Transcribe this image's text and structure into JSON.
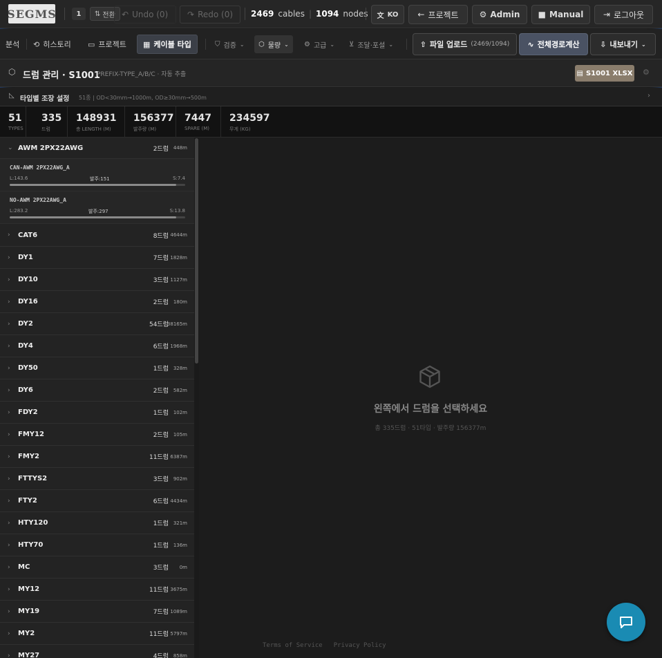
{
  "topbar": {
    "logo_text": "SEGMS",
    "badge": "1",
    "switch_label": "전환",
    "undo_label": "Undo (0)",
    "redo_label": "Redo (0)",
    "cables_count": "2469",
    "cables_label": "cables",
    "nodes_count": "1094",
    "nodes_label": "nodes",
    "lang_label": "KO",
    "project_label": "프로젝트",
    "admin_label": "Admin",
    "manual_label": "Manual",
    "logout_label": "로그아웃"
  },
  "nav": {
    "analysis": "분석",
    "history": "히스토리",
    "project": "프로젝트",
    "cable_type": "케이블 타입",
    "verify": "검증",
    "quantity": "물량",
    "advanced": "고급",
    "procure": "조달·포설",
    "upload_label": "파일 업로드",
    "upload_count": "(2469/1094)",
    "route_calc": "전체경로계산",
    "export": "내보내기"
  },
  "drum_header": {
    "title": "드럼 관리 · S1001",
    "subtitle": "PREFIX-TYPE_A/B/C · 자동 추출",
    "xlsx_label": "S1001 XLSX"
  },
  "adjust": {
    "title": "타입별 조장 설정",
    "subtitle": "51종 | OD<30mm→1000m, OD≥30mm→500m"
  },
  "stats": [
    {
      "value": "51",
      "label": "TYPES"
    },
    {
      "value": "335",
      "label": "드럼"
    },
    {
      "value": "148931",
      "label": "총 LENGTH (M)"
    },
    {
      "value": "156377",
      "label": "발주량 (M)"
    },
    {
      "value": "7447",
      "label": "SPARE (M)"
    },
    {
      "value": "234597",
      "label": "무게 (KG)"
    }
  ],
  "open_group": {
    "name": "AWM 2PX22AWG",
    "count": "2드럼",
    "length": "448m",
    "drums": [
      {
        "name": "CAN-AWM 2PX22AWG_A",
        "l": "L:143.6",
        "order": "발주:151",
        "s": "S:7.4",
        "fill_pct": 95
      },
      {
        "name": "NO-AWM 2PX22AWG_A",
        "l": "L:283.2",
        "order": "발주:297",
        "s": "S:13.8",
        "fill_pct": 95
      }
    ]
  },
  "groups": [
    {
      "name": "CAT6",
      "count": "8드럼",
      "length": "4644m"
    },
    {
      "name": "DY1",
      "count": "7드럼",
      "length": "1828m"
    },
    {
      "name": "DY10",
      "count": "3드럼",
      "length": "1127m"
    },
    {
      "name": "DY16",
      "count": "2드럼",
      "length": "180m"
    },
    {
      "name": "DY2",
      "count": "54드럼",
      "length": "38165m"
    },
    {
      "name": "DY4",
      "count": "6드럼",
      "length": "1968m"
    },
    {
      "name": "DY50",
      "count": "1드럼",
      "length": "328m"
    },
    {
      "name": "DY6",
      "count": "2드럼",
      "length": "582m"
    },
    {
      "name": "FDY2",
      "count": "1드럼",
      "length": "102m"
    },
    {
      "name": "FMY12",
      "count": "2드럼",
      "length": "105m"
    },
    {
      "name": "FMY2",
      "count": "11드럼",
      "length": "6387m"
    },
    {
      "name": "FTTYS2",
      "count": "3드럼",
      "length": "902m"
    },
    {
      "name": "FTY2",
      "count": "6드럼",
      "length": "4434m"
    },
    {
      "name": "HTY120",
      "count": "1드럼",
      "length": "321m"
    },
    {
      "name": "HTY70",
      "count": "1드럼",
      "length": "136m"
    },
    {
      "name": "MC",
      "count": "3드럼",
      "length": "0m"
    },
    {
      "name": "MY12",
      "count": "11드럼",
      "length": "3675m"
    },
    {
      "name": "MY19",
      "count": "7드럼",
      "length": "1089m"
    },
    {
      "name": "MY2",
      "count": "11드럼",
      "length": "5797m"
    },
    {
      "name": "MY27",
      "count": "4드럼",
      "length": "858m"
    }
  ],
  "empty": {
    "title": "왼쪽에서 드럼을 선택하세요",
    "subtitle": "총 335드럼 · 51타입 · 발주량 156377m"
  },
  "footer": {
    "terms": "Terms of Service",
    "privacy": "Privacy Policy"
  },
  "colors": {
    "accent": "#1a8bb3",
    "xlsx": "#8a7d6c",
    "primary_btn": "#4a5263"
  }
}
